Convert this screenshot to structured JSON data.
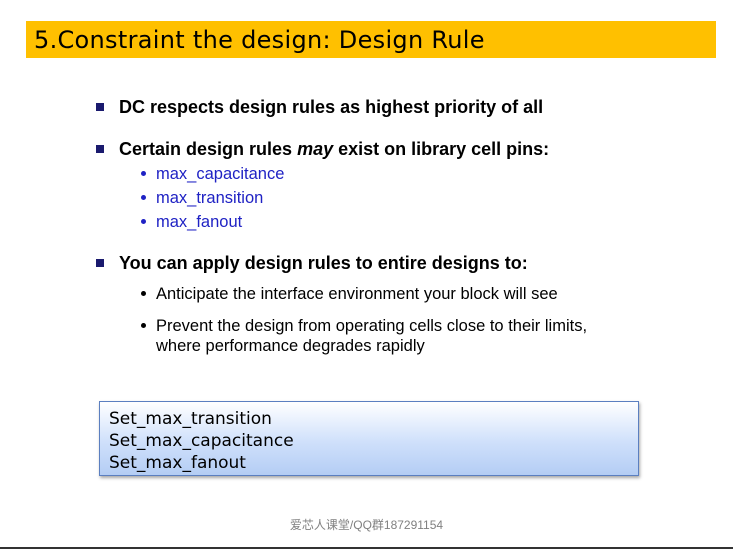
{
  "slide": {
    "title": "5.Constraint the design: Design Rule",
    "bullets": [
      {
        "text": "DC respects design rules as highest priority of all"
      },
      {
        "text_before": "Certain design rules ",
        "text_em": "may",
        "text_after": " exist on library cell pins:",
        "subitems": [
          "max_capacitance",
          "max_transition",
          "max_fanout"
        ]
      },
      {
        "text": "You can apply design rules to entire designs to:",
        "subitems": [
          {
            "line1": "Anticipate the interface environment your block will see"
          },
          {
            "line1": "Prevent the design from operating cells close to their limits,",
            "line2": "where performance degrades rapidly"
          }
        ]
      }
    ],
    "code_box": {
      "lines": [
        "Set_max_transition",
        "Set_max_capacitance",
        "Set_max_fanout"
      ]
    },
    "footer": "爱芯人课堂/QQ群187291154"
  },
  "colors": {
    "title_bar": "#ffc000",
    "bullet_square": "#1a1a6e",
    "sub_blue": "#1f22c4",
    "code_box_border": "#5b7fc0"
  }
}
